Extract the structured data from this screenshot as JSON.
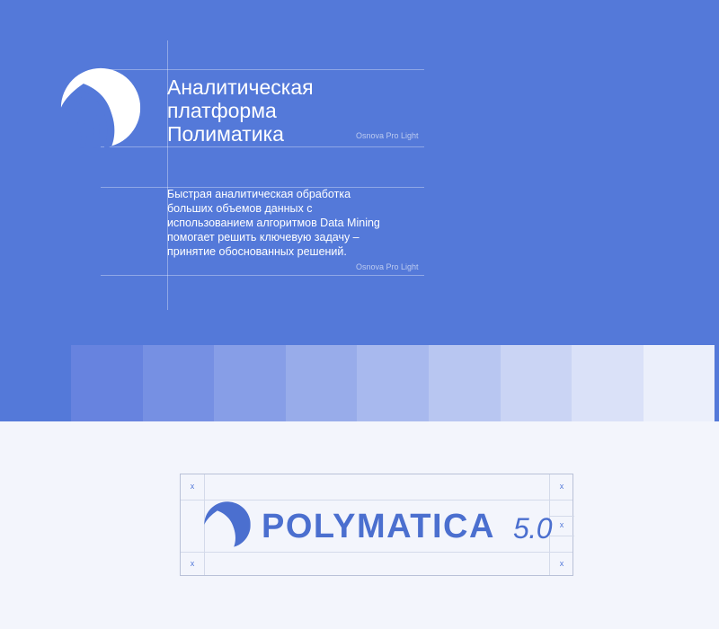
{
  "header": {
    "title_lines": [
      "Аналитическая",
      "платформа",
      "Полиматика"
    ],
    "title_font_note": "Osnova Pro Light"
  },
  "description": {
    "text": "Быстрая аналитическая обработка больших объемов данных с использованием алгоритмов Data Mining помогает решить ключевую задачу – принятие обоснованных решений.",
    "font_note": "Osnova Pro Light"
  },
  "logo": {
    "icon": "shell-fan-icon",
    "brand_name": "POLYMATICA",
    "version": "5.0",
    "clearspace_mark": "x"
  },
  "colors": {
    "primary": "#5479d9",
    "brand_text": "#4b6fcf",
    "background_light": "#f3f5fc",
    "palette": [
      "#6783df",
      "#7690e3",
      "#879ee7",
      "#98acea",
      "#a8b9ee",
      "#b8c6f1",
      "#cad4f4",
      "#dae1f8",
      "#ebeffb"
    ]
  }
}
